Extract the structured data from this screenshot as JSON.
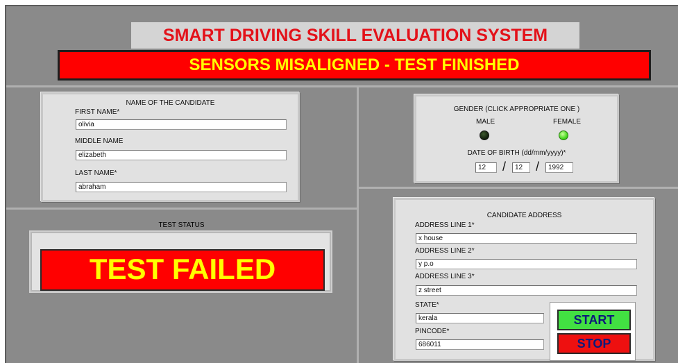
{
  "header": {
    "title": "SMART DRIVING SKILL EVALUATION SYSTEM",
    "status_banner": "SENSORS  MISALIGNED - TEST FINISHED"
  },
  "candidate_name": {
    "heading": "NAME OF THE CANDIDATE",
    "first_name_label": "FIRST NAME*",
    "first_name_value": "olivia",
    "middle_name_label": "MIDDLE NAME",
    "middle_name_value": "elizabeth",
    "last_name_label": "LAST NAME*",
    "last_name_value": "abraham"
  },
  "gender_dob": {
    "heading": "GENDER (CLICK APPROPRIATE ONE )",
    "male_label": "MALE",
    "female_label": "FEMALE",
    "male_selected": false,
    "female_selected": true,
    "dob_label": "DATE OF BIRTH (dd/mm/yyyy)*",
    "dob_day": "12",
    "dob_month": "12",
    "dob_year": "1992",
    "separator": "/"
  },
  "test_status": {
    "heading": "TEST STATUS",
    "result": "TEST FAILED"
  },
  "address": {
    "heading": "CANDIDATE ADDRESS",
    "line1_label": "ADDRESS LINE 1*",
    "line1_value": "x house",
    "line2_label": "ADDRESS LINE 2*",
    "line2_value": "y p.o",
    "line3_label": "ADDRESS LINE 3*",
    "line3_value": "z street",
    "state_label": "STATE*",
    "state_value": "kerala",
    "pincode_label": "PINCODE*",
    "pincode_value": "686011"
  },
  "controls": {
    "start_label": "START",
    "stop_label": "STOP"
  },
  "colors": {
    "background": "#8a8a8a",
    "panel": "#e1e1e1",
    "alert_red": "#ff0000",
    "alert_yellow": "#ffff00",
    "title_red": "#e3121a",
    "led_on": "#48d81f",
    "button_green": "#42e042",
    "button_red": "#ee1010"
  }
}
